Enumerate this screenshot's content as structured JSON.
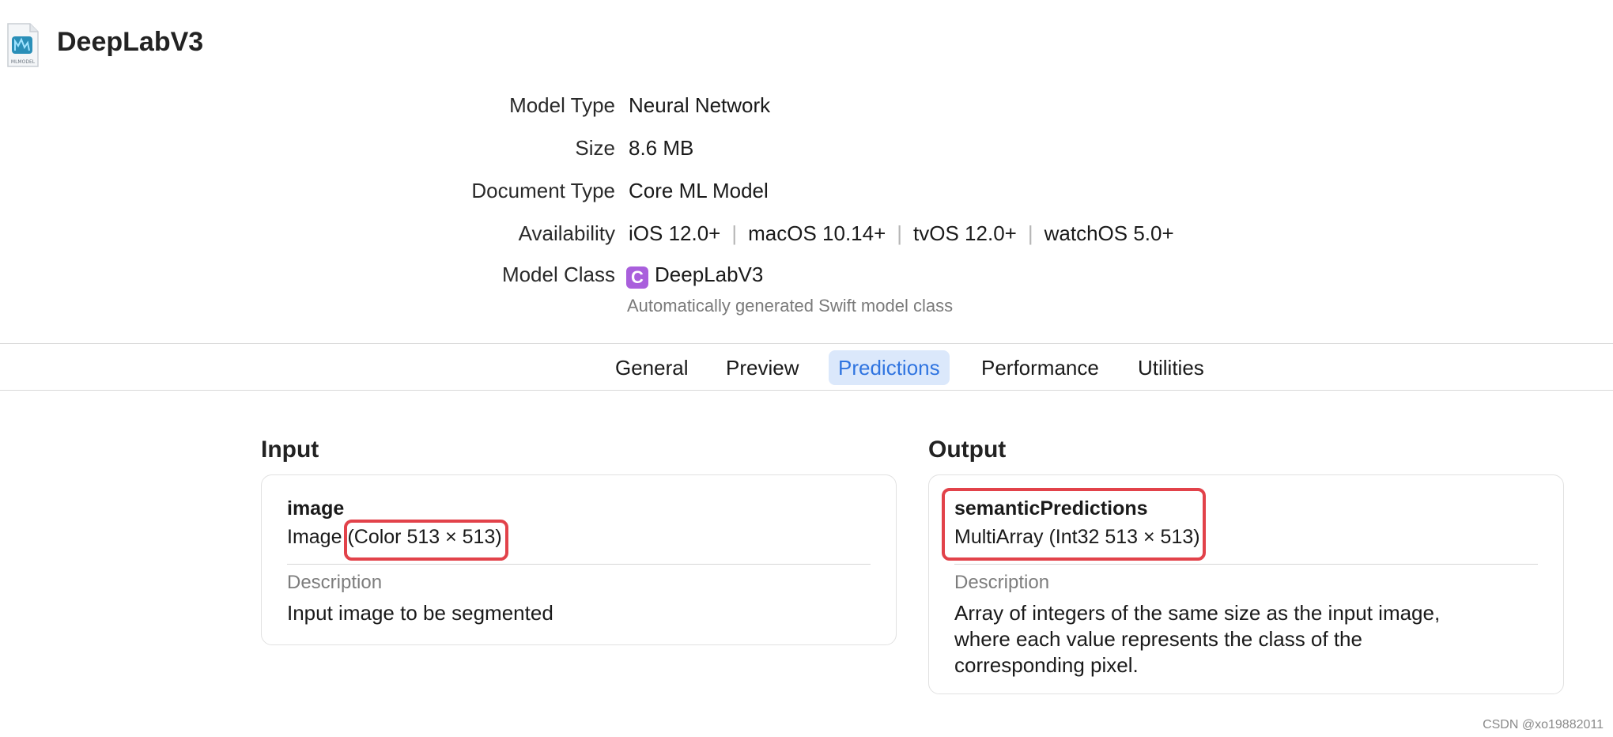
{
  "header": {
    "icon_label": "MLMODEL",
    "title": "DeepLabV3"
  },
  "metadata": {
    "model_type": {
      "label": "Model Type",
      "value": "Neural Network"
    },
    "size": {
      "label": "Size",
      "value": "8.6 MB"
    },
    "document_type": {
      "label": "Document Type",
      "value": "Core ML Model"
    },
    "availability": {
      "label": "Availability",
      "platforms": [
        "iOS 12.0+",
        "macOS 10.14+",
        "tvOS 12.0+",
        "watchOS 5.0+"
      ],
      "separator": "|"
    },
    "model_class": {
      "label": "Model Class",
      "badge": "C",
      "value": "DeepLabV3",
      "note": "Automatically generated Swift model class"
    }
  },
  "tabs": {
    "items": [
      "General",
      "Preview",
      "Predictions",
      "Performance",
      "Utilities"
    ],
    "active": "Predictions"
  },
  "input": {
    "title": "Input",
    "name": "image",
    "type_prefix": "Image",
    "type_detail": "(Color 513 × 513)",
    "description_label": "Description",
    "description": "Input image to be segmented"
  },
  "output": {
    "title": "Output",
    "name": "semanticPredictions",
    "type": "MultiArray (Int32 513 × 513)",
    "description_label": "Description",
    "description_lines": [
      "Array of integers of the same size as the input image,",
      "where each value represents the class of the",
      "corresponding pixel."
    ]
  },
  "colors": {
    "accent": "#2f74e0",
    "active_tab_bg": "#dbe8fb",
    "highlight": "#e2424a",
    "class_badge": "#a95fdc"
  },
  "watermark": "CSDN @xo19882011"
}
